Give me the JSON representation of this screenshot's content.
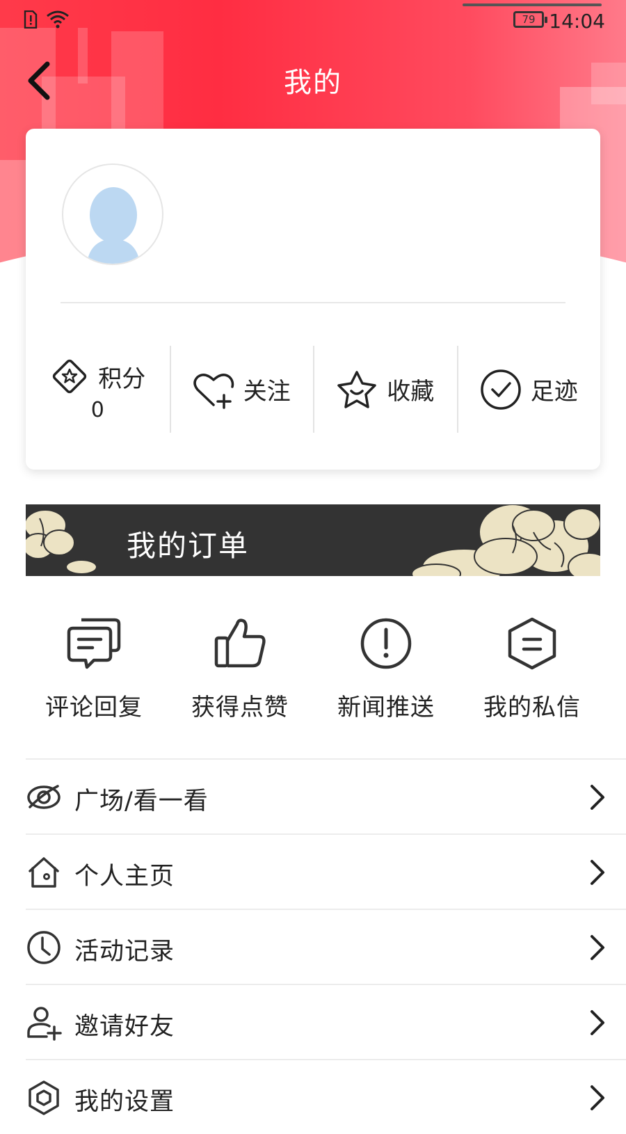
{
  "status_bar": {
    "battery": "79",
    "time": "14:04"
  },
  "nav": {
    "title": "我的"
  },
  "stats": {
    "points_label": "积分",
    "points_value": "0",
    "follow_label": "关注",
    "favorites_label": "收藏",
    "history_label": "足迹"
  },
  "orders_banner": {
    "title": "我的订单"
  },
  "quick_actions": [
    {
      "label": "评论回复",
      "icon": "comment-reply-icon"
    },
    {
      "label": "获得点赞",
      "icon": "thumbs-up-icon"
    },
    {
      "label": "新闻推送",
      "icon": "alert-icon"
    },
    {
      "label": "我的私信",
      "icon": "message-hexagon-icon"
    }
  ],
  "menu": [
    {
      "label": "广场/看一看",
      "icon": "eye-icon"
    },
    {
      "label": "个人主页",
      "icon": "home-icon"
    },
    {
      "label": "活动记录",
      "icon": "clock-icon"
    },
    {
      "label": "邀请好友",
      "icon": "add-user-icon"
    },
    {
      "label": "我的设置",
      "icon": "settings-hexagon-icon"
    }
  ],
  "colors": {
    "header_red": "#ff2d42",
    "banner_dark": "#333333",
    "avatar_blue": "#bcd8f2"
  }
}
